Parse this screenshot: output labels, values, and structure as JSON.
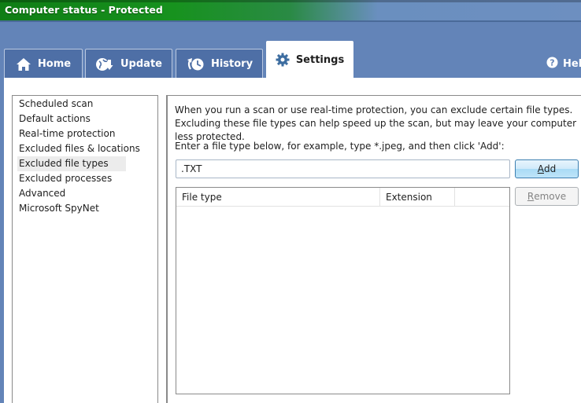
{
  "window": {
    "title": "Computer status - Protected"
  },
  "tabs": [
    {
      "label": "Home",
      "icon": "home-icon",
      "active": false
    },
    {
      "label": "Update",
      "icon": "update-icon",
      "active": false
    },
    {
      "label": "History",
      "icon": "history-icon",
      "active": false
    },
    {
      "label": "Settings",
      "icon": "gear-icon",
      "active": true
    }
  ],
  "help": {
    "label": "Help",
    "icon": "help-icon"
  },
  "settings_nav": {
    "items": [
      {
        "label": "Scheduled scan"
      },
      {
        "label": "Default actions"
      },
      {
        "label": "Real-time protection"
      },
      {
        "label": "Excluded files & locations"
      },
      {
        "label": "Excluded file types",
        "selected": true
      },
      {
        "label": "Excluded processes"
      },
      {
        "label": "Advanced"
      },
      {
        "label": "Microsoft SpyNet"
      }
    ]
  },
  "panel": {
    "description": "When you run a scan or use real-time protection, you can exclude certain file types. Excluding these file types can help speed up the scan, but may leave your computer less protected.",
    "prompt": "Enter a file type below, for example, type *.jpeg, and then click 'Add':",
    "input_value": ".TXT",
    "add_button": {
      "accel": "A",
      "rest": "dd"
    },
    "remove_button": {
      "accel": "R",
      "rest": "emove",
      "enabled": false
    },
    "list_columns": [
      "File type",
      "Extension",
      ""
    ],
    "list_rows": []
  },
  "colors": {
    "title_green": "#17921e",
    "chrome_blue": "#6384b8",
    "tab_blue": "#4e6fa6",
    "gear_blue": "#3d6da0"
  }
}
